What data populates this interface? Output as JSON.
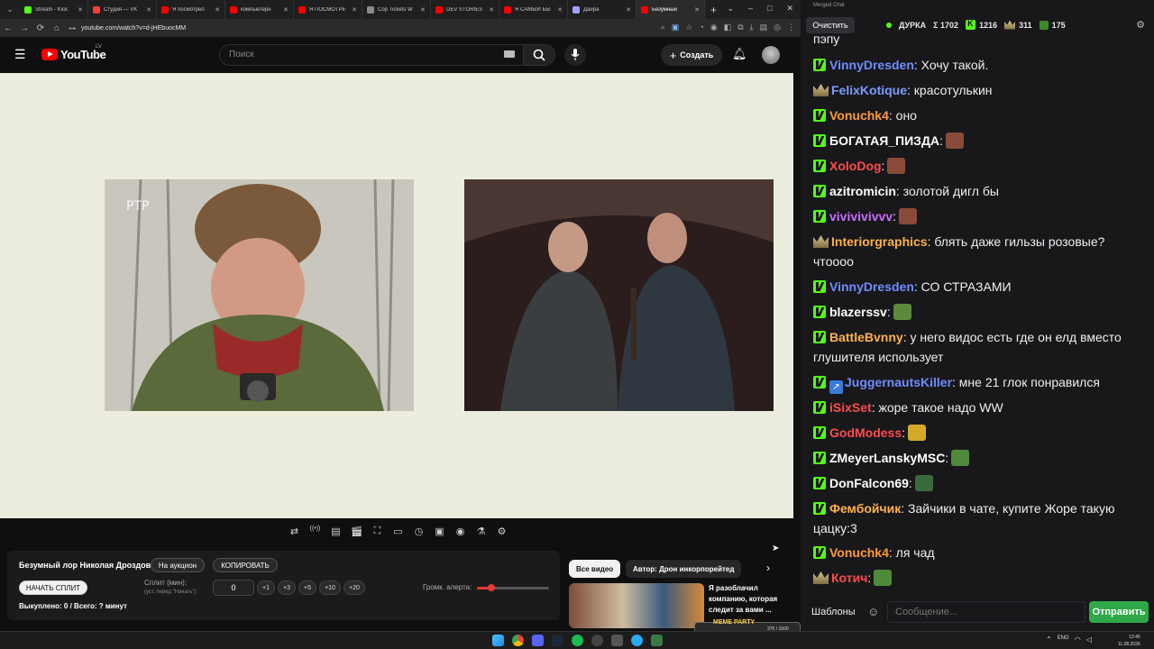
{
  "browser": {
    "tabs": [
      {
        "label": "Stream - Kick",
        "favicon_color": "#53fc18"
      },
      {
        "label": "Студия — VK",
        "favicon_color": "#ff3b3b"
      },
      {
        "label": "Я посмотрел",
        "favicon_color": "#ff0000"
      },
      {
        "label": "компьютерн",
        "favicon_color": "#ff0000"
      },
      {
        "label": "Я ПОСМОТРЕ",
        "favicon_color": "#ff0000"
      },
      {
        "label": "Cop Tickets W",
        "favicon_color": "#8a8a8a"
      },
      {
        "label": "DEV STORIES",
        "favicon_color": "#ff0000"
      },
      {
        "label": "Я САМЫЙ БЫ",
        "favicon_color": "#ff0000"
      },
      {
        "label": "Дайра",
        "favicon_color": "#9fa0ff"
      },
      {
        "label": "Безумный",
        "favicon_color": "#ff0000"
      }
    ],
    "new_tab": "+",
    "url": "youtube.com/watch?v=d-jHEbuocMM"
  },
  "youtube": {
    "logo_text": "YouTube",
    "region": "LV",
    "search_placeholder": "Поиск",
    "create_label": "Создать",
    "colors": {
      "brand": "#ff0000"
    }
  },
  "tools_icons": [
    "repeat-icon",
    "broadcast-icon",
    "playlist-icon",
    "clapper-icon",
    "fullscreen-icon",
    "miniplayer-icon",
    "speed-icon",
    "subtitle-icon",
    "screenshot-icon",
    "lab-icon",
    "settings-icon"
  ],
  "split_panel": {
    "video_title": "Безумный лор Николая Дроздова",
    "auction_label": "На аукцион",
    "copy_label": "КОПИРОВАТЬ",
    "start_split_label": "НАЧАТЬ СПЛИТ",
    "split_label": "Сплит (мин):",
    "split_hint": "(уст. перед \"Начать\")",
    "split_value": "0",
    "steps": [
      "+1",
      "+3",
      "+5",
      "+10",
      "+20"
    ],
    "volume_label": "Громк. алерта:",
    "volume_fraction": 0.2,
    "bought_label": "Выкуплено: 0 / Всего: ? минут"
  },
  "related": {
    "chips": [
      "Все видео",
      "Автор: Дрон инкорпорейтед"
    ],
    "video_title": "Я разоблачил компанию, которая следит за вами ..."
  },
  "chat": {
    "window_title": "Merged Chat",
    "clear_label": "Очистить",
    "channel": "ДУРКА",
    "stats": {
      "total": "Σ 1702",
      "kick": "1216",
      "twitch": "311",
      "other": "175"
    },
    "top_partial": "пэпу",
    "messages": [
      {
        "user": "VinnyDresden",
        "color": "#6f8cff",
        "badge": "kick",
        "text": " Хочу такой."
      },
      {
        "user": "FelixKotique",
        "color": "#7b9cff",
        "badge": "crown",
        "text": " красотулькин"
      },
      {
        "user": "Vonuchk4",
        "color": "#ff9a3c",
        "badge": "kick",
        "text": " оно"
      },
      {
        "user": "БОГАТАЯ_ПИЗДА",
        "color": "#ffffff",
        "badge": "kick",
        "text": "",
        "emote": "#8a4a3a"
      },
      {
        "user": "XoloDog",
        "color": "#ff4b4b",
        "badge": "kick",
        "text": "",
        "emote": "#8a4a3a"
      },
      {
        "user": "azitromicin",
        "color": "#ffffff",
        "badge": "kick",
        "text": " золотой дигл бы"
      },
      {
        "user": "vivivivivvv",
        "color": "#c86bff",
        "badge": "kick",
        "text": "",
        "emote": "#8a4a3a"
      },
      {
        "user": "Interiorgraphics",
        "color": "#ffb24a",
        "badge": "crown",
        "text": " блять даже гильзы розовые? чтoooo"
      },
      {
        "user": "VinnyDresden",
        "color": "#6f8cff",
        "badge": "kick",
        "text": " СО СТРАЗАМИ"
      },
      {
        "user": "blazerssv",
        "color": "#ffffff",
        "badge": "kick",
        "text": "",
        "emote": "#5d8a3a"
      },
      {
        "user": "BattleBvnny",
        "color": "#ffb24a",
        "badge": "kick",
        "text": " у него видос есть где он елд вместо глушителя использует"
      },
      {
        "user": "JuggernautsKiller",
        "color": "#6f8cff",
        "badge": "kick-arrow",
        "text": " мне 21 глок понравился"
      },
      {
        "user": "iSixSet",
        "color": "#ff4b4b",
        "badge": "kick",
        "text": " жоре такое надо WW"
      },
      {
        "user": "GodModess",
        "color": "#ff4b4b",
        "badge": "kick",
        "text": "",
        "emote": "#d4a92a"
      },
      {
        "user": "ZMeyerLanskyMSC",
        "color": "#ffffff",
        "badge": "kick",
        "text": "",
        "emote": "#4f8a3a"
      },
      {
        "user": "DonFalcon69",
        "color": "#ffffff",
        "badge": "kick",
        "text": "",
        "emote": "#3a6a3a"
      },
      {
        "user": "Фембойчик",
        "color": "#ffb24a",
        "badge": "kick",
        "text": " Зайчики в чате, купите Жоре такую цацку:3"
      },
      {
        "user": "Vonuchk4",
        "color": "#ff9a3c",
        "badge": "kick",
        "text": " ля чад"
      },
      {
        "user": "Котич",
        "color": "#ff4b4b",
        "badge": "crown",
        "text": "",
        "emote": "#4f8a3a"
      }
    ],
    "templates_label": "Шаблоны",
    "input_placeholder": "Сообщение...",
    "send_label": "Отправить"
  },
  "taskbar": {
    "lang": "ENG",
    "time": "13:45",
    "date": "11.08.2026",
    "overlay_label": "MEME PARTY",
    "overlay_counter": "376 / 1500"
  }
}
